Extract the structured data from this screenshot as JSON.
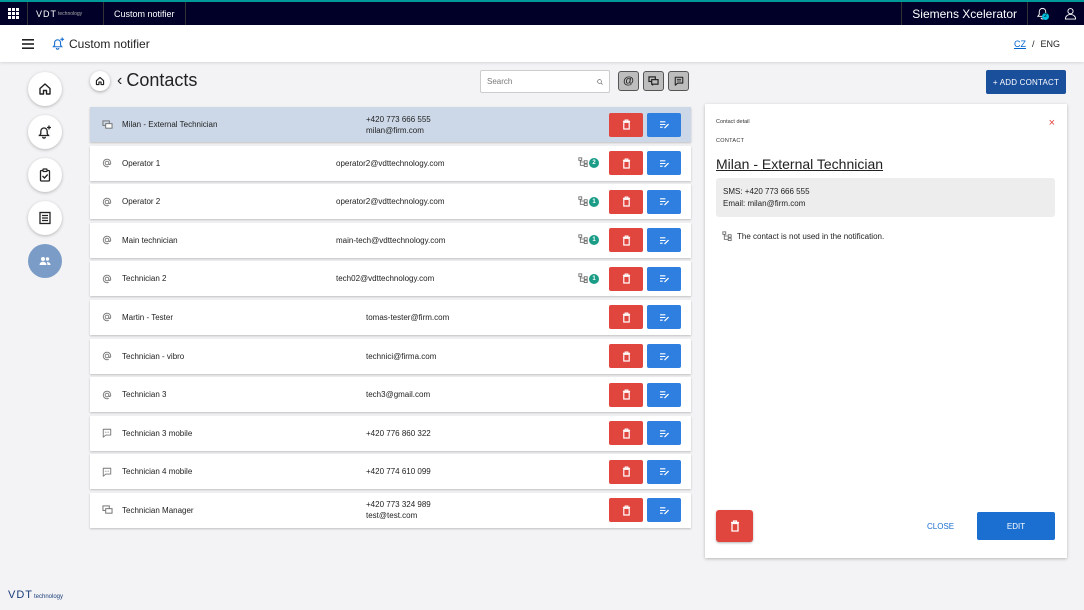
{
  "topbar": {
    "logo_main": "VDT",
    "logo_sub": "technology",
    "app_tab": "Custom notifier",
    "brand": "Siemens Xcelerator",
    "notification_count": "2"
  },
  "header": {
    "title": "Custom notifier",
    "lang_cz": "CZ",
    "lang_sep": "/",
    "lang_eng": "ENG"
  },
  "page": {
    "back": "‹",
    "title": "Contacts",
    "search_placeholder": "Search",
    "filter_email": "@",
    "add_contact": "+ ADD CONTACT"
  },
  "contacts": [
    {
      "type": "both",
      "name": "Milan - External Technician",
      "line1": "+420 773 666 555",
      "line2": "milan@firm.com",
      "usage": "",
      "selected": true
    },
    {
      "type": "email",
      "name": "Operator 1",
      "line1": "operator2@vdttechnology.com",
      "line2": "",
      "usage": "2"
    },
    {
      "type": "email",
      "name": "Operator 2",
      "line1": "operator2@vdttechnology.com",
      "line2": "",
      "usage": "1"
    },
    {
      "type": "email",
      "name": "Main technician",
      "line1": "main-tech@vdttechnology.com",
      "line2": "",
      "usage": "1"
    },
    {
      "type": "email",
      "name": "Technician 2",
      "line1": "tech02@vdttechnology.com",
      "line2": "",
      "usage": "1"
    },
    {
      "type": "email",
      "name": "Martin - Tester",
      "line1": "tomas-tester@firm.com",
      "line2": "",
      "usage": ""
    },
    {
      "type": "email",
      "name": "Technician - vibro",
      "line1": "technici@firma.com",
      "line2": "",
      "usage": ""
    },
    {
      "type": "email",
      "name": "Technician 3",
      "line1": "tech3@gmail.com",
      "line2": "",
      "usage": ""
    },
    {
      "type": "sms",
      "name": "Technician 3 mobile",
      "line1": "+420 776 860 322",
      "line2": "",
      "usage": ""
    },
    {
      "type": "sms",
      "name": "Technician 4 mobile",
      "line1": "+420 774 610 099",
      "line2": "",
      "usage": ""
    },
    {
      "type": "both",
      "name": "Technician Manager",
      "line1": "+420 773 324 989",
      "line2": "test@test.com",
      "usage": ""
    }
  ],
  "detail": {
    "label": "Contact detail",
    "close_x": "×",
    "section": "CONTACT",
    "name": "Milan - External Technician",
    "sms": "SMS: +420 773 666 555",
    "email": "Email: milan@firm.com",
    "note": "The contact is not used in the notification.",
    "close_btn": "CLOSE",
    "edit_btn": "EDIT"
  },
  "footer": {
    "logo_main": "VDT",
    "logo_sub": "technology"
  },
  "colors": {
    "topbar": "#000028",
    "accent": "#009999",
    "primary": "#1a4f9c",
    "delete": "#e0453e",
    "edit": "#2f7fe0",
    "selected_row": "#ccd8e8",
    "usage_badge": "#1a9c87"
  },
  "icons": {
    "apps": "apps-grid-icon",
    "notification": "bell-icon",
    "user": "user-icon",
    "menu": "hamburger-icon",
    "app": "bell-plus-icon",
    "nav": [
      "home-icon",
      "bell-plus-icon",
      "clipboard-check-icon",
      "list-icon",
      "contacts-icon"
    ],
    "search": "search-icon",
    "delete": "trash-icon",
    "edit": "edit-list-icon",
    "usage": "hierarchy-icon"
  }
}
